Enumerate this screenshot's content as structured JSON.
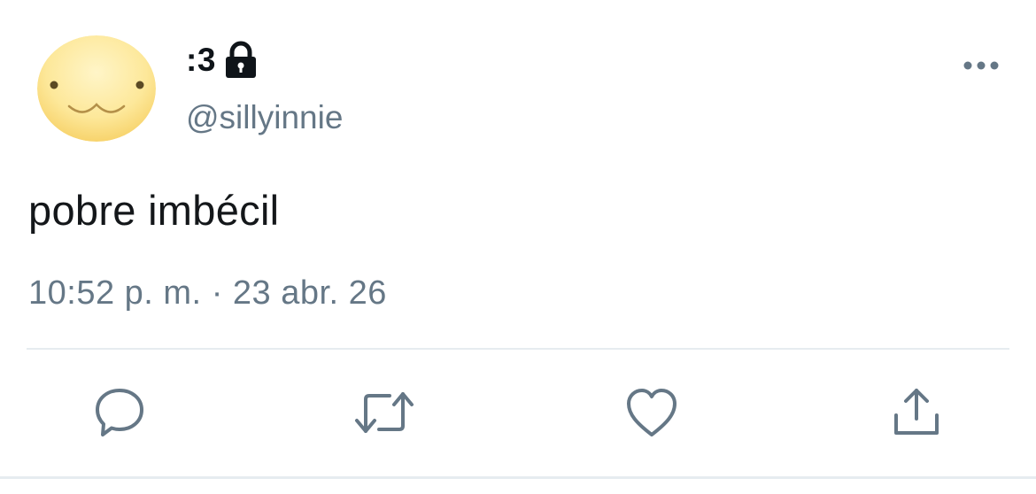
{
  "user": {
    "display_name": ":3",
    "handle": "@sillyinnie",
    "protected_icon": "lock-icon",
    "avatar": "smiling-face-avatar"
  },
  "tweet": {
    "text": "pobre imbécil",
    "time": "10:52 p. m.",
    "separator": "·",
    "date": "23 abr. 26"
  },
  "actions": [
    {
      "icon": "reply-icon"
    },
    {
      "icon": "retweet-icon"
    },
    {
      "icon": "like-icon"
    },
    {
      "icon": "share-icon"
    }
  ],
  "menu": {
    "icon": "more-options-icon"
  },
  "colors": {
    "text_primary": "#14171a",
    "text_secondary": "#657786",
    "divider": "#e6ecf0",
    "avatar_fill": "#fde89a"
  }
}
